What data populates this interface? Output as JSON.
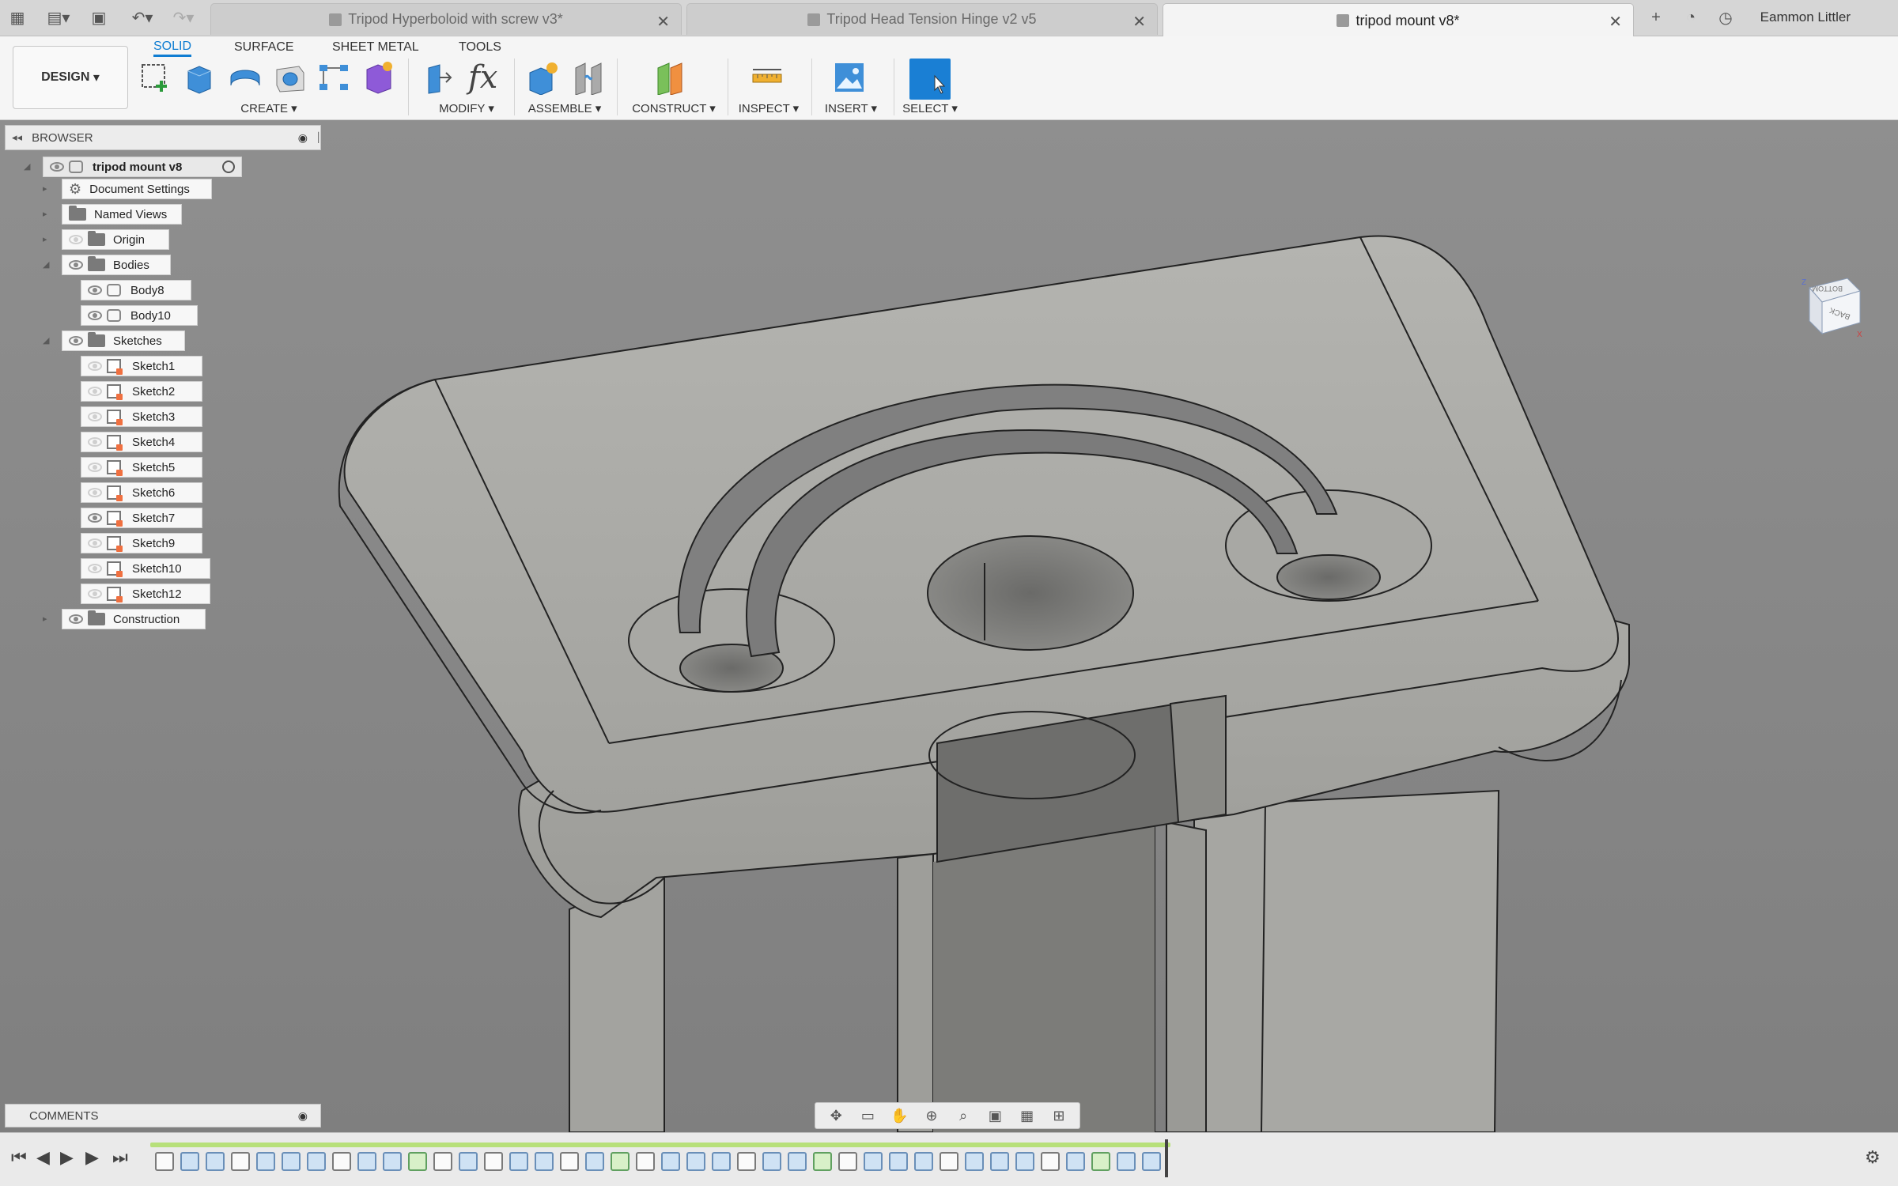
{
  "titlebar": {
    "tabs": [
      {
        "label": "Tripod Hyperboloid with screw v3*",
        "active": false
      },
      {
        "label": "Tripod Head Tension Hinge v2 v5",
        "active": false
      },
      {
        "label": "tripod mount v8*",
        "active": true
      }
    ],
    "user": "Eammon Littler",
    "icons": [
      "grid-menu-icon",
      "file-icon",
      "save-icon",
      "undo-icon",
      "redo-icon",
      "new-tab-icon",
      "extensions-icon",
      "job-status-icon"
    ]
  },
  "ribbon": {
    "workspace": "DESIGN",
    "tabs": [
      {
        "label": "SOLID",
        "active": true
      },
      {
        "label": "SURFACE",
        "active": false
      },
      {
        "label": "SHEET METAL",
        "active": false
      },
      {
        "label": "TOOLS",
        "active": false
      }
    ],
    "groups": [
      "CREATE",
      "MODIFY",
      "ASSEMBLE",
      "CONSTRUCT",
      "INSPECT",
      "INSERT",
      "SELECT"
    ]
  },
  "browser": {
    "title": "BROWSER",
    "root": "tripod mount v8",
    "items": [
      {
        "label": "Document Settings",
        "kind": "settings"
      },
      {
        "label": "Named Views",
        "kind": "folder"
      },
      {
        "label": "Origin",
        "kind": "folder"
      },
      {
        "label": "Bodies",
        "kind": "folder"
      },
      {
        "label": "Body8",
        "kind": "body"
      },
      {
        "label": "Body10",
        "kind": "body"
      },
      {
        "label": "Sketches",
        "kind": "folder"
      },
      {
        "label": "Sketch1",
        "kind": "sketch"
      },
      {
        "label": "Sketch2",
        "kind": "sketch"
      },
      {
        "label": "Sketch3",
        "kind": "sketch"
      },
      {
        "label": "Sketch4",
        "kind": "sketch"
      },
      {
        "label": "Sketch5",
        "kind": "sketch"
      },
      {
        "label": "Sketch6",
        "kind": "sketch"
      },
      {
        "label": "Sketch7",
        "kind": "sketch"
      },
      {
        "label": "Sketch9",
        "kind": "sketch"
      },
      {
        "label": "Sketch10",
        "kind": "sketch"
      },
      {
        "label": "Sketch12",
        "kind": "sketch"
      },
      {
        "label": "Construction",
        "kind": "folder"
      }
    ]
  },
  "comments": {
    "title": "COMMENTS"
  },
  "viewcube": {
    "faces": [
      "BOTTOM",
      "BACK"
    ],
    "axes": [
      "Z",
      "X"
    ]
  },
  "colors": {
    "accent": "#0f7dd2",
    "select_button": "#1a7fd4",
    "model": "#a6a6a2"
  }
}
